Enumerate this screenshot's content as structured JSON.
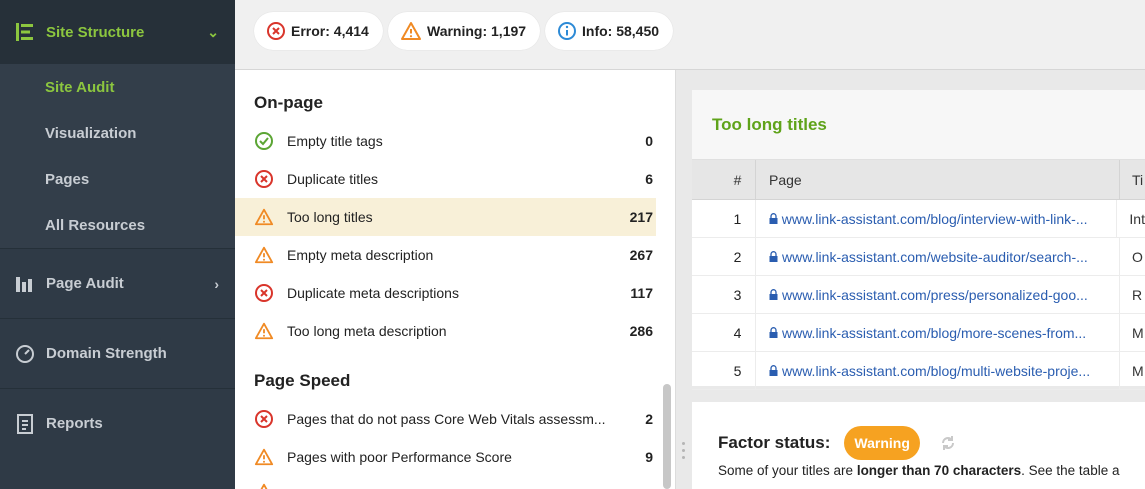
{
  "sidebar": {
    "site_structure": "Site Structure",
    "sub_items": [
      "Site Audit",
      "Visualization",
      "Pages",
      "All Resources"
    ],
    "page_audit": "Page Audit",
    "domain_strength": "Domain Strength",
    "reports": "Reports"
  },
  "summary": {
    "error": "Error: 4,414",
    "warning": "Warning: 1,197",
    "info": "Info: 58,450"
  },
  "list": {
    "onpage_title": "On-page",
    "onpage_items": [
      {
        "label": "Empty title tags",
        "count": "0",
        "status": "ok"
      },
      {
        "label": "Duplicate titles",
        "count": "6",
        "status": "error"
      },
      {
        "label": "Too long titles",
        "count": "217",
        "status": "warning"
      },
      {
        "label": "Empty meta description",
        "count": "267",
        "status": "warning"
      },
      {
        "label": "Duplicate meta descriptions",
        "count": "117",
        "status": "error"
      },
      {
        "label": "Too long meta description",
        "count": "286",
        "status": "warning"
      }
    ],
    "speed_title": "Page Speed",
    "speed_items": [
      {
        "label": "Pages that do not pass Core Web Vitals assessm...",
        "count": "2",
        "status": "error"
      },
      {
        "label": "Pages with poor Performance Score",
        "count": "9",
        "status": "warning"
      }
    ]
  },
  "detail": {
    "title": "Too long titles",
    "columns": {
      "num": "#",
      "page": "Page",
      "title": "Ti"
    },
    "rows": [
      {
        "num": "1",
        "page": "www.link-assistant.com/blog/interview-with-link-...",
        "title": "Int"
      },
      {
        "num": "2",
        "page": "www.link-assistant.com/website-auditor/search-...",
        "title": "O"
      },
      {
        "num": "3",
        "page": "www.link-assistant.com/press/personalized-goo...",
        "title": "R"
      },
      {
        "num": "4",
        "page": "www.link-assistant.com/blog/more-scenes-from...",
        "title": "M"
      },
      {
        "num": "5",
        "page": "www.link-assistant.com/blog/multi-website-proje...",
        "title": "M"
      }
    ]
  },
  "factor": {
    "label": "Factor status:",
    "badge": "Warning",
    "desc_prefix": "Some of your titles are ",
    "desc_bold": "longer than 70 characters",
    "desc_suffix": ". See the table a"
  },
  "colors": {
    "accent_green": "#8cc63f",
    "error_red": "#d9352b",
    "warning_orange": "#f08a24",
    "info_blue": "#2d8ad6",
    "link_blue": "#2a5db0"
  }
}
